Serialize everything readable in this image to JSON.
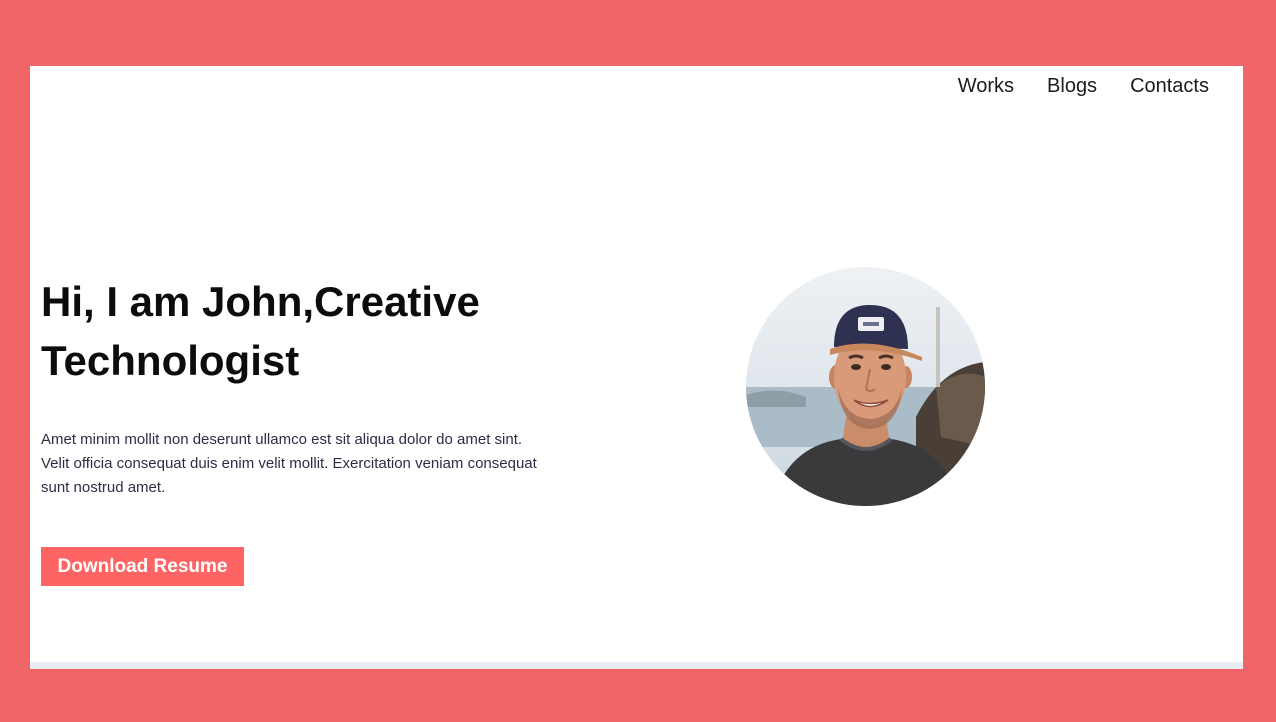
{
  "nav": {
    "items": [
      {
        "label": "Works"
      },
      {
        "label": "Blogs"
      },
      {
        "label": "Contacts"
      }
    ]
  },
  "hero": {
    "title_line1": "Hi, I am John,Creative",
    "title_line2": "Technologist",
    "description": "Amet minim mollit non deserunt ullamco est sit aliqua dolor do amet sint. Velit officia consequat duis enim velit mollit. Exercitation veniam consequat sunt nostrud amet.",
    "cta_label": "Download Resume"
  },
  "colors": {
    "page_background": "#f06567",
    "accent": "#ff6464",
    "heading": "#0c0c0c",
    "body_text": "#2b2f45"
  }
}
